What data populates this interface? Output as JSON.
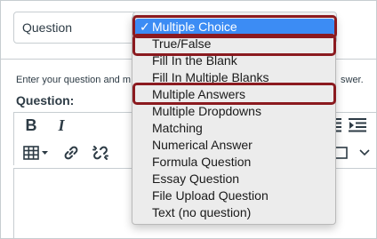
{
  "header": {
    "title_value": "Question"
  },
  "instruction": {
    "text_start": "Enter your question and m",
    "text_end": "swer."
  },
  "question_label": "Question:",
  "toolbar": {
    "bold_label": "B",
    "italic_label": "I"
  },
  "dropdown": {
    "check_mark": "✓",
    "options": [
      {
        "label": "Multiple Choice",
        "selected": true
      },
      {
        "label": "True/False",
        "selected": false
      },
      {
        "label": "Fill In the Blank",
        "selected": false
      },
      {
        "label": "Fill In Multiple Blanks",
        "selected": false
      },
      {
        "label": "Multiple Answers",
        "selected": false
      },
      {
        "label": "Multiple Dropdowns",
        "selected": false
      },
      {
        "label": "Matching",
        "selected": false
      },
      {
        "label": "Numerical Answer",
        "selected": false
      },
      {
        "label": "Formula Question",
        "selected": false
      },
      {
        "label": "Essay Question",
        "selected": false
      },
      {
        "label": "File Upload Question",
        "selected": false
      },
      {
        "label": "Text (no question)",
        "selected": false
      }
    ],
    "highlighted": [
      "Multiple Choice",
      "True/False",
      "Multiple Answers"
    ]
  },
  "colors": {
    "selected_bg": "#3c8cf4",
    "highlight_border": "#8b1a1f",
    "text": "#2d3b45"
  },
  "icons": [
    "table-icon",
    "link-icon",
    "unlink-icon",
    "indent-icon",
    "outdent-icon",
    "chevron-down-icon",
    "select-arrows-icon"
  ]
}
